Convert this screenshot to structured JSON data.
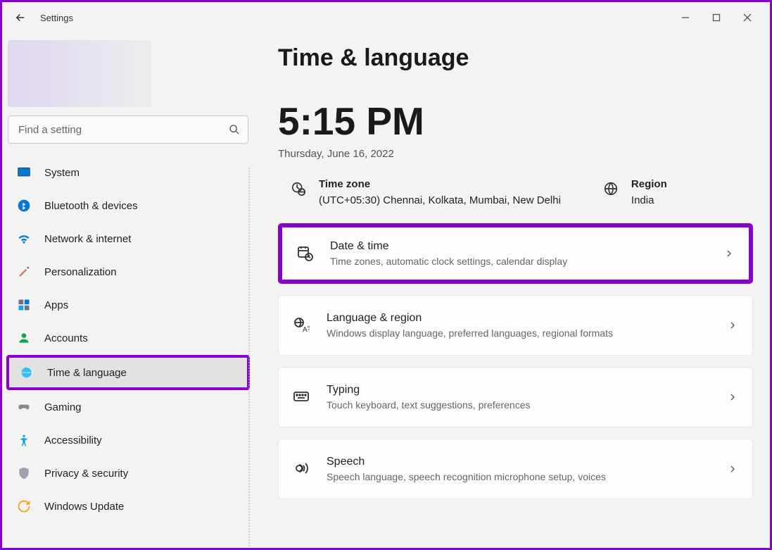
{
  "app_title": "Settings",
  "search_placeholder": "Find a setting",
  "page_header": "Time & language",
  "clock": {
    "time": "5:15 PM",
    "date": "Thursday, June 16, 2022"
  },
  "info": {
    "timezone": {
      "label": "Time zone",
      "value": "(UTC+05:30) Chennai, Kolkata, Mumbai, New Delhi"
    },
    "region": {
      "label": "Region",
      "value": "India"
    }
  },
  "nav": [
    {
      "label": "System"
    },
    {
      "label": "Bluetooth & devices"
    },
    {
      "label": "Network & internet"
    },
    {
      "label": "Personalization"
    },
    {
      "label": "Apps"
    },
    {
      "label": "Accounts"
    },
    {
      "label": "Time & language"
    },
    {
      "label": "Gaming"
    },
    {
      "label": "Accessibility"
    },
    {
      "label": "Privacy & security"
    },
    {
      "label": "Windows Update"
    }
  ],
  "cards": [
    {
      "title": "Date & time",
      "sub": "Time zones, automatic clock settings, calendar display"
    },
    {
      "title": "Language & region",
      "sub": "Windows display language, preferred languages, regional formats"
    },
    {
      "title": "Typing",
      "sub": "Touch keyboard, text suggestions, preferences"
    },
    {
      "title": "Speech",
      "sub": "Speech language, speech recognition microphone setup, voices"
    }
  ]
}
